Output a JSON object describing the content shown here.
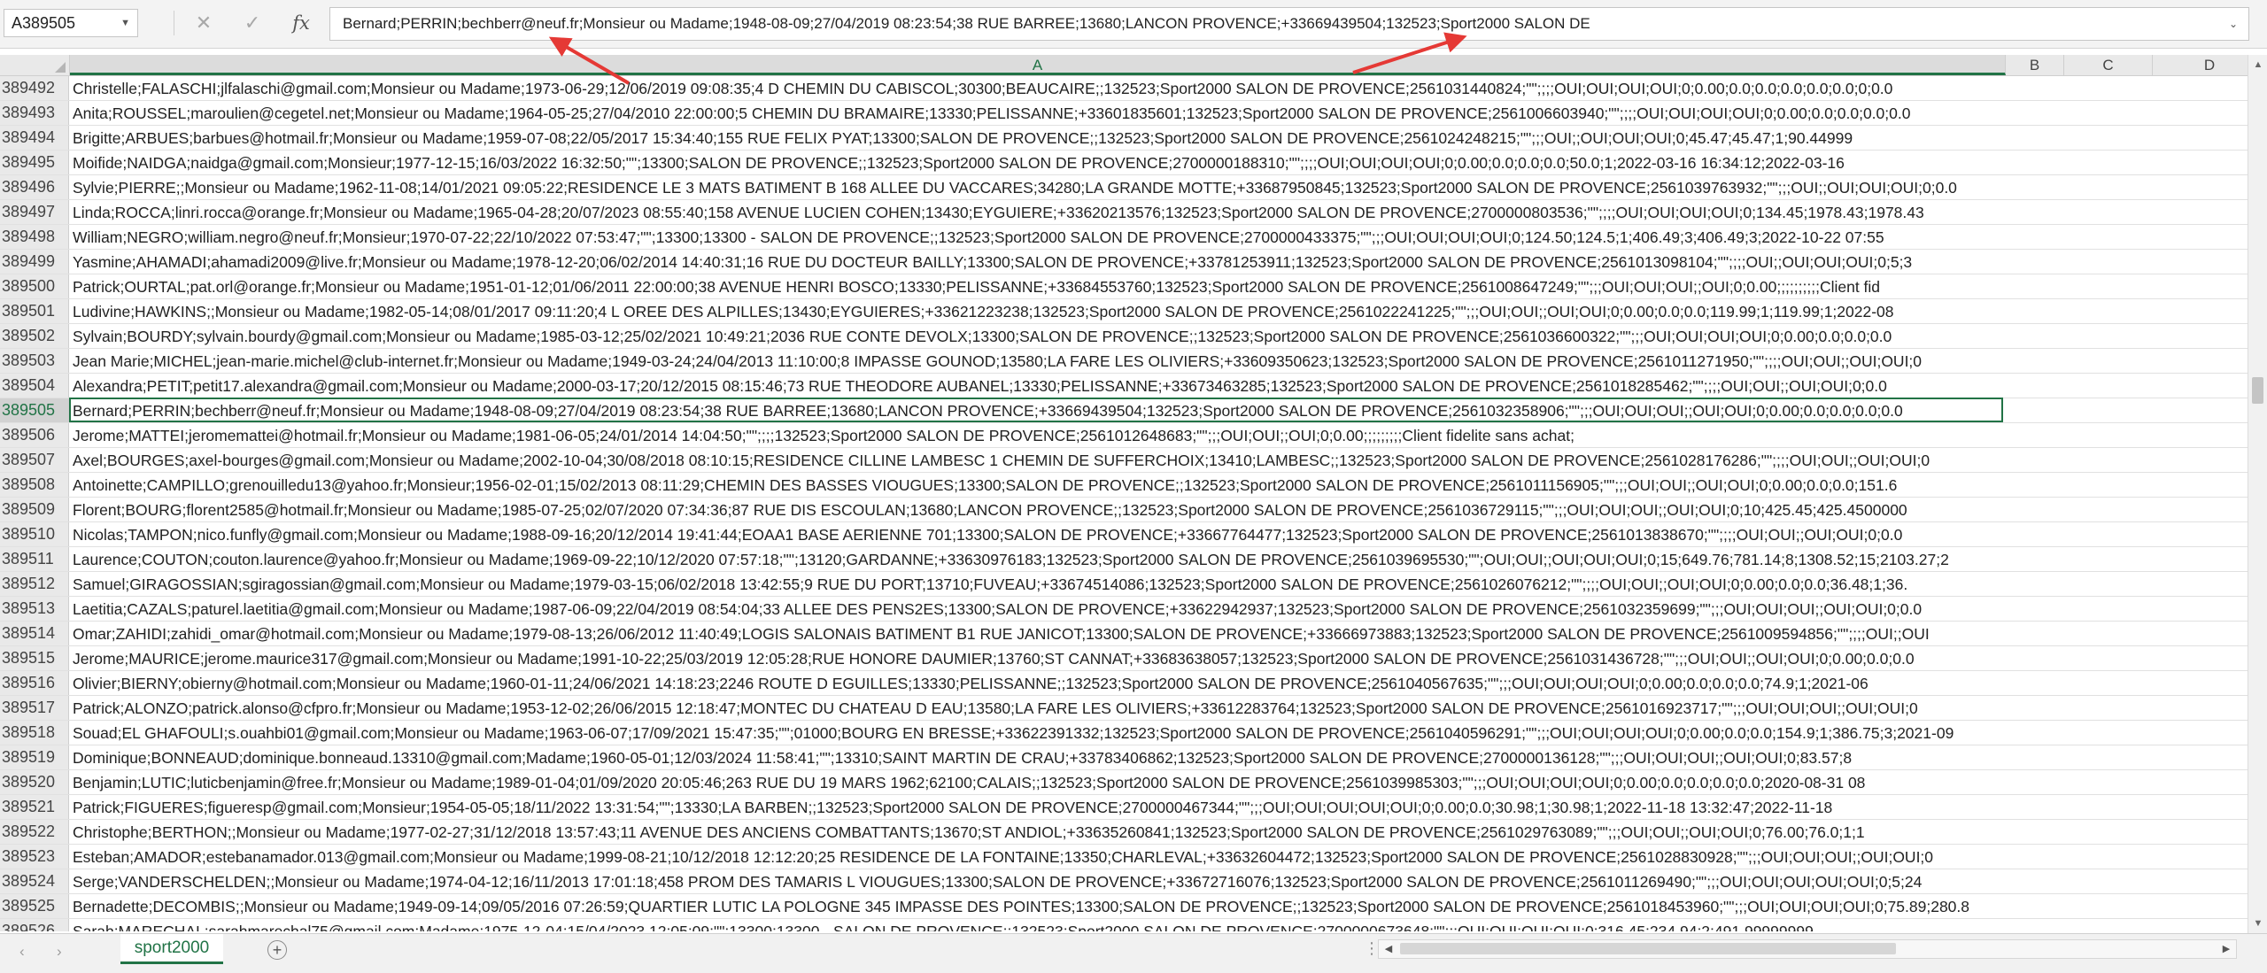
{
  "name_box": {
    "value": "A389505"
  },
  "formula_bar": {
    "cancel_icon": "close-icon",
    "enter_icon": "checkmark-icon",
    "fx_label": "fx",
    "value": "Bernard;PERRIN;bechberr@neuf.fr;Monsieur ou Madame;1948-08-09;27/04/2019 08:23:54;38 RUE BARREE;13680;LANCON PROVENCE;+33669439504;132523;Sport2000 SALON DE"
  },
  "columns": [
    "A",
    "B",
    "C",
    "D"
  ],
  "rows": [
    {
      "num": "389492",
      "text": "Christelle;FALASCHI;jlfalaschi@gmail.com;Monsieur ou Madame;1973-06-29;12/06/2019 09:08:35;4 D CHEMIN DU CABISCOL;30300;BEAUCAIRE;;132523;Sport2000 SALON DE PROVENCE;2561031440824;\"\";;;;OUI;OUI;OUI;OUI;0;0.00;0.0;0.0;0.0;0.0;0.0;0;0.0"
    },
    {
      "num": "389493",
      "text": "Anita;ROUSSEL;maroulien@cegetel.net;Monsieur ou Madame;1964-05-25;27/04/2010 22:00:00;5 CHEMIN DU BRAMAIRE;13330;PELISSANNE;+33601835601;132523;Sport2000 SALON DE PROVENCE;2561006603940;\"\";;;;OUI;OUI;OUI;OUI;0;0.00;0.0;0.0;0.0;0.0"
    },
    {
      "num": "389494",
      "text": "Brigitte;ARBUES;barbues@hotmail.fr;Monsieur ou Madame;1959-07-08;22/05/2017 15:34:40;155 RUE FELIX PYAT;13300;SALON DE PROVENCE;;132523;Sport2000 SALON DE PROVENCE;2561024248215;\"\";;;OUI;;OUI;OUI;OUI;0;45.47;45.47;1;90.44999"
    },
    {
      "num": "389495",
      "text": "Moifide;NAIDGA;naidga@gmail.com;Monsieur;1977-12-15;16/03/2022 16:32:50;\"\";13300;SALON  DE PROVENCE;;132523;Sport2000 SALON DE PROVENCE;2700000188310;\"\";;;;OUI;OUI;OUI;OUI;0;0.00;0.0;0.0;0.0;50.0;1;2022-03-16 16:34:12;2022-03-16"
    },
    {
      "num": "389496",
      "text": "Sylvie;PIERRE;;Monsieur ou Madame;1962-11-08;14/01/2021 09:05:22;RESIDENCE LE 3 MATS BATIMENT B 168 ALLEE DU VACCARES;34280;LA GRANDE MOTTE;+33687950845;132523;Sport2000 SALON DE PROVENCE;2561039763932;\"\";;;OUI;;OUI;OUI;OUI;0;0.0"
    },
    {
      "num": "389497",
      "text": "Linda;ROCCA;linri.rocca@orange.fr;Monsieur ou Madame;1965-04-28;20/07/2023 08:55:40;158 AVENUE LUCIEN COHEN;13430;EYGUIERE;+33620213576;132523;Sport2000 SALON DE PROVENCE;2700000803536;\"\";;;;OUI;OUI;OUI;OUI;0;134.45;1978.43;1978.43"
    },
    {
      "num": "389498",
      "text": "William;NEGRO;william.negro@neuf.fr;Monsieur;1970-07-22;22/10/2022 07:53:47;\"\";13300;13300  - SALON DE PROVENCE;;132523;Sport2000 SALON DE PROVENCE;2700000433375;\"\";;;OUI;OUI;OUI;OUI;0;124.50;124.5;1;406.49;3;406.49;3;2022-10-22 07:55"
    },
    {
      "num": "389499",
      "text": "Yasmine;AHAMADI;ahamadi2009@live.fr;Monsieur ou Madame;1978-12-20;06/02/2014 14:40:31;16 RUE DU DOCTEUR BAILLY;13300;SALON DE PROVENCE;+33781253911;132523;Sport2000 SALON DE PROVENCE;2561013098104;\"\";;;;OUI;;OUI;OUI;OUI;0;5;3"
    },
    {
      "num": "389500",
      "text": "Patrick;OURTAL;pat.orl@orange.fr;Monsieur ou Madame;1951-01-12;01/06/2011 22:00:00;38 AVENUE HENRI BOSCO;13330;PELISSANNE;+33684553760;132523;Sport2000 SALON DE PROVENCE;2561008647249;\"\";;;OUI;OUI;OUI;;OUI;0;0.00;;;;;;;;;;Client fid"
    },
    {
      "num": "389501",
      "text": "Ludivine;HAWKINS;;Monsieur ou Madame;1982-05-14;08/01/2017 09:11:20;4 L OREE DES ALPILLES;13430;EYGUIERES;+33621223238;132523;Sport2000 SALON DE PROVENCE;2561022241225;\"\";;;OUI;OUI;;OUI;OUI;0;0.00;0.0;0.0;119.99;1;119.99;1;2022-08"
    },
    {
      "num": "389502",
      "text": "Sylvain;BOURDY;sylvain.bourdy@gmail.com;Monsieur ou Madame;1985-03-12;25/02/2021 10:49:21;2036 RUE CONTE DEVOLX;13300;SALON DE PROVENCE;;132523;Sport2000 SALON DE PROVENCE;2561036600322;\"\";;;OUI;OUI;OUI;OUI;0;0.00;0.0;0.0;0.0"
    },
    {
      "num": "389503",
      "text": "Jean Marie;MICHEL;jean-marie.michel@club-internet.fr;Monsieur ou Madame;1949-03-24;24/04/2013 11:10:00;8 IMPASSE GOUNOD;13580;LA FARE LES OLIVIERS;+33609350623;132523;Sport2000 SALON DE PROVENCE;2561011271950;\"\";;;;OUI;OUI;;OUI;OUI;0"
    },
    {
      "num": "389504",
      "text": "Alexandra;PETIT;petit17.alexandra@gmail.com;Monsieur ou Madame;2000-03-17;20/12/2015 08:15:46;73 RUE THEODORE AUBANEL;13330;PELISSANNE;+33673463285;132523;Sport2000 SALON DE PROVENCE;2561018285462;\"\";;;;OUI;OUI;;OUI;OUI;0;0.0"
    },
    {
      "num": "389505",
      "text": "Bernard;PERRIN;bechberr@neuf.fr;Monsieur ou Madame;1948-08-09;27/04/2019 08:23:54;38 RUE BARREE;13680;LANCON PROVENCE;+33669439504;132523;Sport2000 SALON DE PROVENCE;2561032358906;\"\";;;OUI;OUI;OUI;;OUI;OUI;0;0.00;0.0;0.0;0.0;0.0"
    },
    {
      "num": "389506",
      "text": "Jerome;MATTEI;jeromemattei@hotmail.fr;Monsieur ou Madame;1981-06-05;24/01/2014 14:04:50;\"\";;;;132523;Sport2000 SALON DE PROVENCE;2561012648683;\"\";;;OUI;OUI;;OUI;0;0.00;;;;;;;;;Client fidelite sans achat;"
    },
    {
      "num": "389507",
      "text": "Axel;BOURGES;axel-bourges@gmail.com;Monsieur ou Madame;2002-10-04;30/08/2018 08:10:15;RESIDENCE CILLINE LAMBESC 1 CHEMIN DE SUFFERCHOIX;13410;LAMBESC;;132523;Sport2000 SALON DE PROVENCE;2561028176286;\"\";;;;OUI;OUI;;OUI;OUI;0"
    },
    {
      "num": "389508",
      "text": "Antoinette;CAMPILLO;grenouilledu13@yahoo.fr;Monsieur;1956-02-01;15/02/2013 08:11:29;CHEMIN DES BASSES VIOUGUES;13300;SALON DE PROVENCE;;132523;Sport2000 SALON DE PROVENCE;2561011156905;\"\";;;OUI;OUI;;OUI;OUI;0;0.00;0.0;0.0;151.6"
    },
    {
      "num": "389509",
      "text": "Florent;BOURG;florent2585@hotmail.fr;Monsieur ou Madame;1985-07-25;02/07/2020 07:34:36;87 RUE DIS ESCOULAN;13680;LANCON PROVENCE;;132523;Sport2000 SALON DE PROVENCE;2561036729115;\"\";;;OUI;OUI;OUI;;OUI;OUI;0;10;425.45;425.4500000"
    },
    {
      "num": "389510",
      "text": "Nicolas;TAMPON;nico.funfly@gmail.com;Monsieur ou Madame;1988-09-16;20/12/2014 19:41:44;EOAA1 BASE AERIENNE 701;13300;SALON DE PROVENCE;+33667764477;132523;Sport2000 SALON DE PROVENCE;2561013838670;\"\";;;;OUI;OUI;;OUI;OUI;0;0.0"
    },
    {
      "num": "389511",
      "text": "Laurence;COUTON;couton.laurence@yahoo.fr;Monsieur ou Madame;1969-09-22;10/12/2020 07:57:18;\"\";13120;GARDANNE;+33630976183;132523;Sport2000 SALON DE PROVENCE;2561039695530;\"\";OUI;OUI;;OUI;OUI;OUI;0;15;649.76;781.14;8;1308.52;15;2103.27;2"
    },
    {
      "num": "389512",
      "text": "Samuel;GIRAGOSSIAN;sgiragossian@gmail.com;Monsieur ou Madame;1979-03-15;06/02/2018 13:42:55;9 RUE DU PORT;13710;FUVEAU;+33674514086;132523;Sport2000 SALON DE PROVENCE;2561026076212;\"\";;;;OUI;OUI;;OUI;OUI;0;0.00;0.0;0.0;36.48;1;36."
    },
    {
      "num": "389513",
      "text": "Laetitia;CAZALS;paturel.laetitia@gmail.com;Monsieur ou Madame;1987-06-09;22/04/2019 08:54:04;33 ALLEE DES PENS2ES;13300;SALON DE PROVENCE;+33622942937;132523;Sport2000 SALON DE PROVENCE;2561032359699;\"\";;;OUI;OUI;OUI;;OUI;OUI;0;0.0"
    },
    {
      "num": "389514",
      "text": "Omar;ZAHIDI;zahidi_omar@hotmail.com;Monsieur ou Madame;1979-08-13;26/06/2012 11:40:49;LOGIS SALONAIS BATIMENT B1 RUE JANICOT;13300;SALON DE PROVENCE;+33666973883;132523;Sport2000 SALON DE PROVENCE;2561009594856;\"\";;;;OUI;;OUI"
    },
    {
      "num": "389515",
      "text": "Jerome;MAURICE;jerome.maurice317@gmail.com;Monsieur ou Madame;1991-10-22;25/03/2019 12:05:28;RUE HONORE DAUMIER;13760;ST CANNAT;+33683638057;132523;Sport2000 SALON DE PROVENCE;2561031436728;\"\";;;OUI;OUI;;OUI;OUI;0;0.00;0.0;0.0"
    },
    {
      "num": "389516",
      "text": "Olivier;BIERNY;obierny@hotmail.com;Monsieur ou Madame;1960-01-11;24/06/2021 14:18:23;2246 ROUTE D EGUILLES;13330;PELISSANNE;;132523;Sport2000 SALON DE PROVENCE;2561040567635;\"\";;;OUI;OUI;OUI;OUI;0;0.00;0.0;0.0;0.0;74.9;1;2021-06"
    },
    {
      "num": "389517",
      "text": "Patrick;ALONZO;patrick.alonso@cfpro.fr;Monsieur ou Madame;1953-12-02;26/06/2015 12:18:47;MONTEC DU CHATEAU D EAU;13580;LA FARE LES OLIVIERS;+33612283764;132523;Sport2000 SALON DE PROVENCE;2561016923717;\"\";;;OUI;OUI;OUI;;OUI;OUI;0"
    },
    {
      "num": "389518",
      "text": "Souad;EL GHAFOULI;s.ouahbi01@gmail.com;Monsieur ou Madame;1963-06-07;17/09/2021 15:47:35;\"\";01000;BOURG EN BRESSE;+33622391332;132523;Sport2000 SALON DE PROVENCE;2561040596291;\"\";;;OUI;OUI;OUI;OUI;0;0.00;0.0;0.0;154.9;1;386.75;3;2021-09"
    },
    {
      "num": "389519",
      "text": "Dominique;BONNEAUD;dominique.bonneaud.13310@gmail.com;Madame;1960-05-01;12/03/2024 11:58:41;\"\";13310;SAINT MARTIN DE CRAU;+33783406862;132523;Sport2000 SALON DE PROVENCE;2700000136128;\"\";;;OUI;OUI;OUI;;OUI;OUI;0;83.57;8"
    },
    {
      "num": "389520",
      "text": "Benjamin;LUTIC;luticbenjamin@free.fr;Monsieur ou Madame;1989-01-04;01/09/2020 20:05:46;263 RUE DU 19 MARS 1962;62100;CALAIS;;132523;Sport2000 SALON DE PROVENCE;2561039985303;\"\";;;OUI;OUI;OUI;OUI;0;0.00;0.0;0.0;0.0;0.0;2020-08-31 08"
    },
    {
      "num": "389521",
      "text": "Patrick;FIGUERES;figueresp@gmail.com;Monsieur;1954-05-05;18/11/2022 13:31:54;\"\";13330;LA BARBEN;;132523;Sport2000 SALON DE PROVENCE;2700000467344;\"\";;;OUI;OUI;OUI;OUI;OUI;0;0.00;0.0;30.98;1;30.98;1;2022-11-18 13:32:47;2022-11-18"
    },
    {
      "num": "389522",
      "text": "Christophe;BERTHON;;Monsieur ou Madame;1977-02-27;31/12/2018 13:57:43;11 AVENUE DES ANCIENS COMBATTANTS;13670;ST ANDIOL;+33635260841;132523;Sport2000 SALON DE PROVENCE;2561029763089;\"\";;;OUI;OUI;;OUI;OUI;0;76.00;76.0;1;1"
    },
    {
      "num": "389523",
      "text": "Esteban;AMADOR;estebanamador.013@gmail.com;Monsieur ou Madame;1999-08-21;10/12/2018 12:12:20;25 RESIDENCE DE LA FONTAINE;13350;CHARLEVAL;+33632604472;132523;Sport2000 SALON DE PROVENCE;2561028830928;\"\";;;OUI;OUI;OUI;;OUI;OUI;0"
    },
    {
      "num": "389524",
      "text": "Serge;VANDERSCHELDEN;;Monsieur ou Madame;1974-04-12;16/11/2013 17:01:18;458 PROM DES TAMARIS L VIOUGUES;13300;SALON DE PROVENCE;+33672716076;132523;Sport2000 SALON DE PROVENCE;2561011269490;\"\";;;OUI;OUI;OUI;OUI;OUI;0;5;24"
    },
    {
      "num": "389525",
      "text": "Bernadette;DECOMBIS;;Monsieur ou Madame;1949-09-14;09/05/2016 07:26:59;QUARTIER LUTIC LA POLOGNE 345 IMPASSE DES POINTES;13300;SALON DE PROVENCE;;132523;Sport2000 SALON DE PROVENCE;2561018453960;\"\";;;OUI;OUI;OUI;OUI;0;75.89;280.8"
    },
    {
      "num": "389526",
      "text": "Sarah;MARECHAL;sarahmarechal75@gmail.com;Madame;1975-12-04;15/04/2023 12:05:09;\"\";13300;13300  - SALON DE PROVENCE;;132523;Sport2000 SALON DE PROVENCE;2700000673648;\"\";;;OUI;OUI;OUI;OUI;0;316.45;234.94;2;491.99999999"
    }
  ],
  "active_row": "389505",
  "sheet_tabs": [
    {
      "label": "sport2000"
    }
  ],
  "colors": {
    "accent": "#217346",
    "annotation_arrow": "#e53935"
  },
  "icons": {
    "name_box_dropdown": "chevron-down-icon",
    "formula_expand": "chevron-down-icon",
    "add_sheet": "plus-circle-icon",
    "sheet_prev": "chevron-left-icon",
    "sheet_next": "chevron-right-icon"
  }
}
